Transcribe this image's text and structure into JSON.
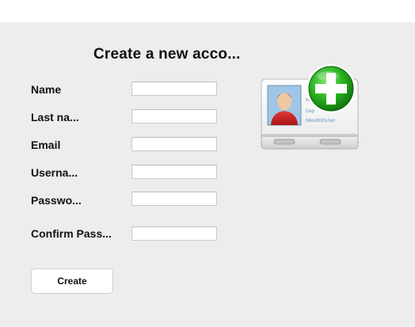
{
  "form": {
    "title": "Create a new acco...",
    "fields": [
      {
        "label": "Name",
        "value": ""
      },
      {
        "label": "Last na...",
        "value": ""
      },
      {
        "label": "Email",
        "value": ""
      },
      {
        "label": "Userna...",
        "value": ""
      },
      {
        "label": "Passwo...",
        "value": ""
      },
      {
        "label": "Confirm Pass...",
        "value": ""
      }
    ],
    "create_label": "Create"
  },
  "icon": {
    "name": "add-contact-card-icon",
    "card_text_line1": "Mike",
    "card_text_line2": "Dep",
    "card_text_line3": "MikeWithUser",
    "accent": "#22a01e"
  }
}
